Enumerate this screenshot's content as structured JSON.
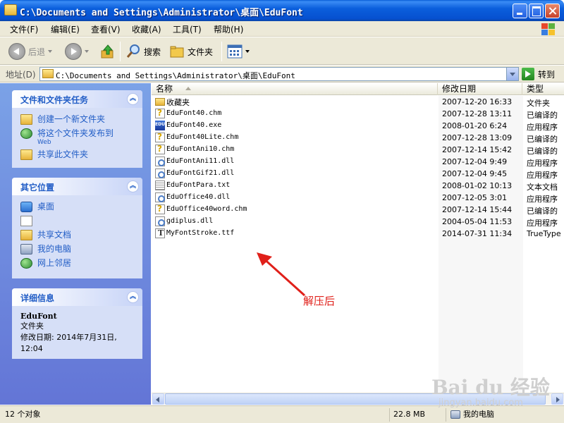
{
  "window": {
    "title": "C:\\Documents and Settings\\Administrator\\桌面\\EduFont"
  },
  "menu": [
    {
      "label": "文件(F)"
    },
    {
      "label": "编辑(E)"
    },
    {
      "label": "查看(V)"
    },
    {
      "label": "收藏(A)"
    },
    {
      "label": "工具(T)"
    },
    {
      "label": "帮助(H)"
    }
  ],
  "toolbar": {
    "back_label": "后退",
    "search_label": "搜索",
    "folders_label": "文件夹"
  },
  "address": {
    "label": "地址(D)",
    "value": "C:\\Documents and Settings\\Administrator\\桌面\\EduFont",
    "go_label": "转到"
  },
  "tasks_panel": {
    "title": "文件和文件夹任务",
    "items": [
      {
        "label": "创建一个新文件夹",
        "icon": "new-folder-icon"
      },
      {
        "label": "将这个文件夹发布到",
        "sub": "Web",
        "icon": "publish-web-icon"
      },
      {
        "label": "共享此文件夹",
        "icon": "share-folder-icon"
      }
    ]
  },
  "places_panel": {
    "title": "其它位置",
    "items": [
      {
        "label": "桌面",
        "icon": "desktop-icon"
      },
      {
        "label": "",
        "icon": "documents-icon"
      },
      {
        "label": "共享文档",
        "icon": "shared-documents-icon"
      },
      {
        "label": "我的电脑",
        "icon": "my-computer-icon"
      },
      {
        "label": "网上邻居",
        "icon": "network-places-icon"
      }
    ]
  },
  "details_panel": {
    "title": "详细信息",
    "name": "EduFont",
    "type": "文件夹",
    "modified": "修改日期: 2014年7月31日, 12:04"
  },
  "columns": {
    "name": "名称",
    "date": "修改日期",
    "type": "类型"
  },
  "files": [
    {
      "name": "收藏夹",
      "date": "2007-12-20 16:33",
      "type": "文件夹",
      "icon": "folder"
    },
    {
      "name": "EduFont40.chm",
      "date": "2007-12-28 13:11",
      "type": "已编译的",
      "icon": "chm"
    },
    {
      "name": "EduFont40.exe",
      "date": "2008-01-20 6:24",
      "type": "应用程序",
      "icon": "exe"
    },
    {
      "name": "EduFont40Lite.chm",
      "date": "2007-12-28 13:09",
      "type": "已编译的",
      "icon": "chm"
    },
    {
      "name": "EduFontAni10.chm",
      "date": "2007-12-14 15:42",
      "type": "已编译的",
      "icon": "chm"
    },
    {
      "name": "EduFontAni11.dll",
      "date": "2007-12-04 9:49",
      "type": "应用程序",
      "icon": "dll"
    },
    {
      "name": "EduFontGif21.dll",
      "date": "2007-12-04 9:45",
      "type": "应用程序",
      "icon": "dll"
    },
    {
      "name": "EduFontPara.txt",
      "date": "2008-01-02 10:13",
      "type": "文本文档",
      "icon": "txt"
    },
    {
      "name": "EduOffice40.dll",
      "date": "2007-12-05 3:01",
      "type": "应用程序",
      "icon": "dll"
    },
    {
      "name": "EduOffice40word.chm",
      "date": "2007-12-14 15:44",
      "type": "已编译的",
      "icon": "chm"
    },
    {
      "name": "gdiplus.dll",
      "date": "2004-05-04 11:53",
      "type": "应用程序",
      "icon": "dll"
    },
    {
      "name": "MyFontStroke.ttf",
      "date": "2014-07-31 11:34",
      "type": "TrueType",
      "icon": "ttf"
    }
  ],
  "annotation": {
    "text": "解压后",
    "color": "#e0201a"
  },
  "status": {
    "count": "12 个对象",
    "size": "22.8 MB",
    "location": "我的电脑"
  },
  "watermark": {
    "main": "Bai du 经验",
    "sub": "jingyan.baidu.com"
  },
  "colors": {
    "titlebar": "#0650d0",
    "taskpane": "#6375d6",
    "link": "#215dc6"
  }
}
